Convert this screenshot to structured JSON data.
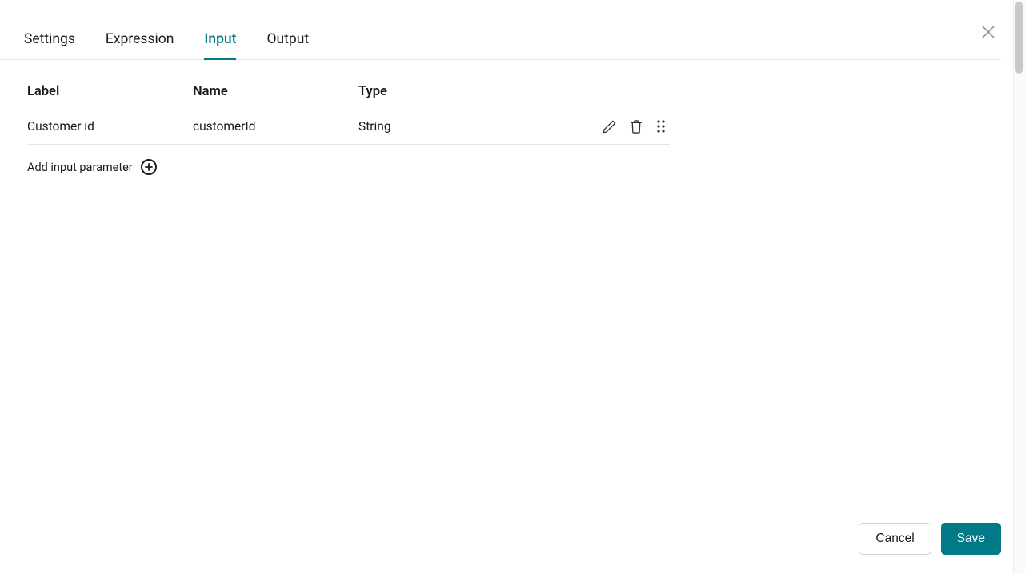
{
  "tabs": {
    "settings": "Settings",
    "expression": "Expression",
    "input": "Input",
    "output": "Output"
  },
  "headers": {
    "label": "Label",
    "name": "Name",
    "type": "Type"
  },
  "rows": [
    {
      "label": "Customer id",
      "name": "customerId",
      "type": "String"
    }
  ],
  "addLabel": "Add input parameter",
  "buttons": {
    "cancel": "Cancel",
    "save": "Save"
  }
}
